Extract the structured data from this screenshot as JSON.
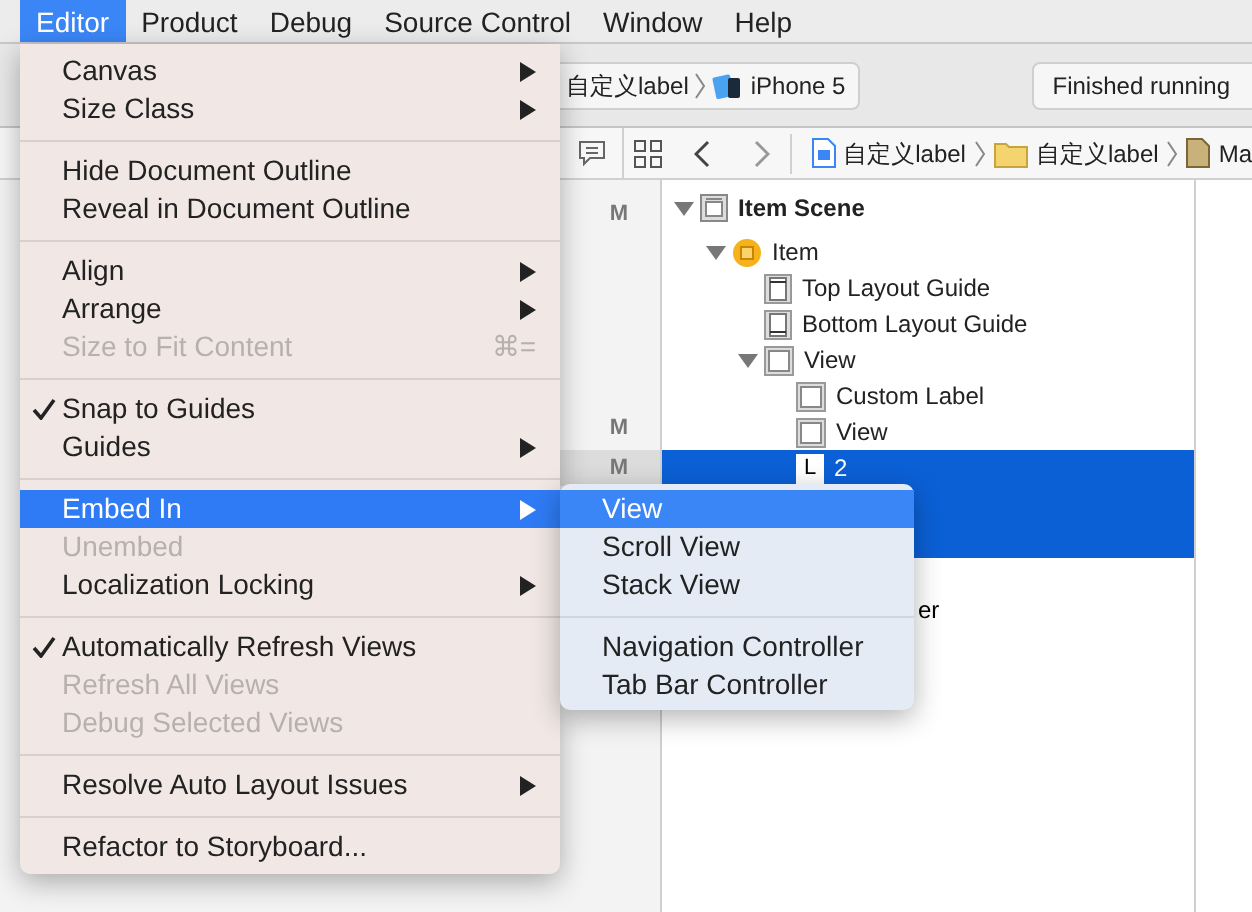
{
  "menu_bar": [
    {
      "label": "Editor",
      "selected": true
    },
    {
      "label": "Product",
      "selected": false
    },
    {
      "label": "Debug",
      "selected": false
    },
    {
      "label": "Source Control",
      "selected": false
    },
    {
      "label": "Window",
      "selected": false
    },
    {
      "label": "Help",
      "selected": false
    }
  ],
  "toolbar": {
    "scheme": "自定义label",
    "device": "iPhone 5",
    "status": "Finished running"
  },
  "jump_bar": [
    {
      "kind": "file",
      "label": "自定义label"
    },
    {
      "kind": "folder",
      "label": "自定义label"
    },
    {
      "kind": "doc",
      "label": "Ma"
    }
  ],
  "change_markers": [
    {
      "text": "M",
      "selected": false
    },
    {
      "text": "M",
      "selected": false
    },
    {
      "text": "M",
      "selected": true
    }
  ],
  "outline": [
    {
      "label": "Item Scene",
      "kind": "scene",
      "expanded": true,
      "selected": false,
      "children": [
        {
          "label": "Item",
          "kind": "controller",
          "expanded": true,
          "selected": false,
          "children": [
            {
              "label": "Top Layout Guide",
              "kind": "top-guide",
              "selected": false
            },
            {
              "label": "Bottom Layout Guide",
              "kind": "bottom-guide",
              "selected": false
            },
            {
              "label": "View",
              "kind": "view",
              "expanded": true,
              "selected": false,
              "children": [
                {
                  "label": "Custom Label",
                  "kind": "view",
                  "selected": false
                },
                {
                  "label": "View",
                  "kind": "view",
                  "selected": false
                },
                {
                  "label": "2",
                  "kind": "label",
                  "icon_text": "L",
                  "selected": true
                }
              ]
            }
          ]
        }
      ]
    }
  ],
  "outline_partial_row": "er",
  "editor_menu": {
    "sections": [
      [
        {
          "label": "Canvas",
          "submenu": true,
          "disabled": false,
          "checked": false,
          "highlighted": false
        },
        {
          "label": "Size Class",
          "submenu": true,
          "disabled": false,
          "checked": false,
          "highlighted": false
        }
      ],
      [
        {
          "label": "Hide Document Outline",
          "submenu": false,
          "disabled": false,
          "checked": false,
          "highlighted": false
        },
        {
          "label": "Reveal in Document Outline",
          "submenu": false,
          "disabled": false,
          "checked": false,
          "highlighted": false
        }
      ],
      [
        {
          "label": "Align",
          "submenu": true,
          "disabled": false,
          "checked": false,
          "highlighted": false
        },
        {
          "label": "Arrange",
          "submenu": true,
          "disabled": false,
          "checked": false,
          "highlighted": false
        },
        {
          "label": "Size to Fit Content",
          "submenu": false,
          "disabled": true,
          "checked": false,
          "highlighted": false,
          "shortcut": "⌘="
        }
      ],
      [
        {
          "label": "Snap to Guides",
          "submenu": false,
          "disabled": false,
          "checked": true,
          "highlighted": false
        },
        {
          "label": "Guides",
          "submenu": true,
          "disabled": false,
          "checked": false,
          "highlighted": false
        }
      ],
      [
        {
          "label": "Embed In",
          "submenu": true,
          "disabled": false,
          "checked": false,
          "highlighted": true
        },
        {
          "label": "Unembed",
          "submenu": false,
          "disabled": true,
          "checked": false,
          "highlighted": false
        },
        {
          "label": "Localization Locking",
          "submenu": true,
          "disabled": false,
          "checked": false,
          "highlighted": false
        }
      ],
      [
        {
          "label": "Automatically Refresh Views",
          "submenu": false,
          "disabled": false,
          "checked": true,
          "highlighted": false
        },
        {
          "label": "Refresh All Views",
          "submenu": false,
          "disabled": true,
          "checked": false,
          "highlighted": false
        },
        {
          "label": "Debug Selected Views",
          "submenu": false,
          "disabled": true,
          "checked": false,
          "highlighted": false
        }
      ],
      [
        {
          "label": "Resolve Auto Layout Issues",
          "submenu": true,
          "disabled": false,
          "checked": false,
          "highlighted": false
        }
      ],
      [
        {
          "label": "Refactor to Storyboard...",
          "submenu": false,
          "disabled": false,
          "checked": false,
          "highlighted": false
        }
      ]
    ]
  },
  "embed_submenu": {
    "sections": [
      [
        {
          "label": "View",
          "selected": true
        },
        {
          "label": "Scroll View",
          "selected": false
        },
        {
          "label": "Stack View",
          "selected": false
        }
      ],
      [
        {
          "label": "Navigation Controller",
          "selected": false
        },
        {
          "label": "Tab Bar Controller",
          "selected": false
        }
      ]
    ]
  }
}
